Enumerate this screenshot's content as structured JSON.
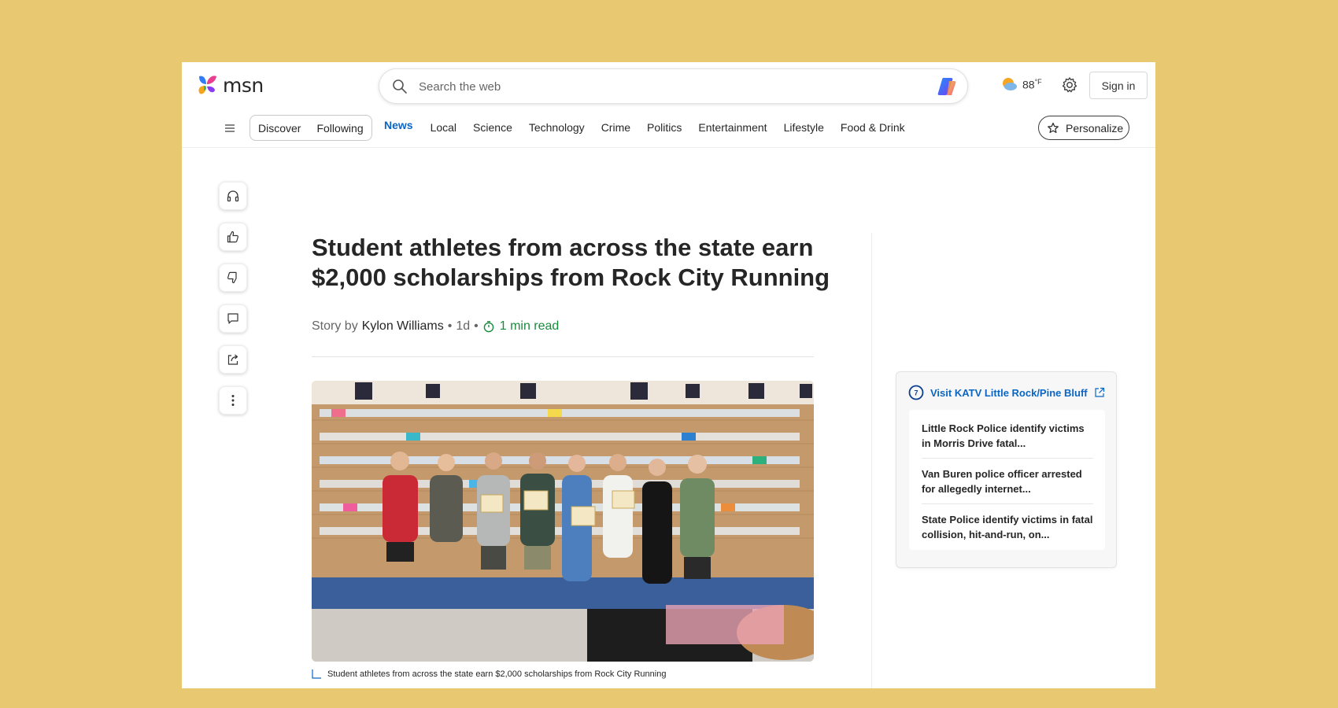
{
  "brand": {
    "name": "msn"
  },
  "search": {
    "placeholder": "Search the web"
  },
  "weather": {
    "temp": "88",
    "unit": "°F",
    "icon": "partly-sunny-icon"
  },
  "header": {
    "signin_label": "Sign in",
    "personalize_label": "Personalize"
  },
  "nav": {
    "pills": [
      "Discover",
      "Following"
    ],
    "links": [
      "News",
      "Local",
      "Science",
      "Technology",
      "Crime",
      "Politics",
      "Entertainment",
      "Lifestyle",
      "Food & Drink"
    ],
    "active": "News"
  },
  "rail": [
    "headphones-icon",
    "thumbs-up-icon",
    "thumbs-down-icon",
    "comment-icon",
    "share-icon",
    "more-icon"
  ],
  "article": {
    "headline": "Student athletes from across the state earn $2,000 scholarships from Rock City Running",
    "story_by": "Story by",
    "author": "Kylon Williams",
    "age": "1d",
    "sep": "•",
    "read_time": "1 min read",
    "caption": "Student athletes from across the state earn $2,000 scholarships from Rock City Running"
  },
  "side_card": {
    "title": "Visit KATV Little Rock/Pine Bluff",
    "items": [
      "Little Rock Police identify victims in Morris Drive fatal...",
      "Van Buren police officer arrested for allegedly internet...",
      "State Police identify victims in fatal collision, hit-and-run, on..."
    ]
  },
  "colors": {
    "accent": "#0b66c3",
    "read_time": "#1a8b3c",
    "background": "#e9c872"
  }
}
